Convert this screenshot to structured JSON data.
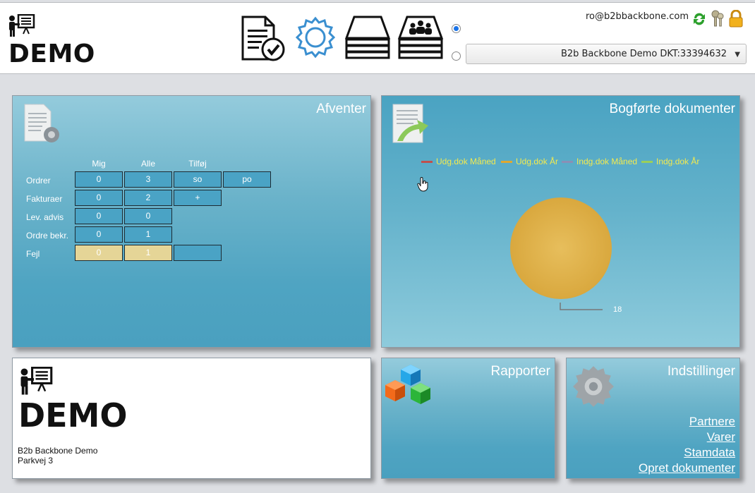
{
  "header": {
    "logo_text": "DEMO",
    "user_email": "ro@b2bbackbone.com",
    "company_select": "B2b Backbone Demo DKT:33394632",
    "toolbar_icons": [
      "documents-approve-icon",
      "settings-gear-icon",
      "stack-icon",
      "users-stack-icon"
    ],
    "top_icons": [
      "refresh-icon",
      "keys-icon",
      "lock-icon"
    ],
    "radio_selected": 1
  },
  "afventer": {
    "title": "Afventer",
    "columns": [
      "Mig",
      "Alle",
      "Tilføj"
    ],
    "rows": [
      {
        "label": "Ordrer",
        "mig": "0",
        "alle": "3",
        "add": [
          "so",
          "po"
        ]
      },
      {
        "label": "Fakturaer",
        "mig": "0",
        "alle": "2",
        "add": [
          "+"
        ]
      },
      {
        "label": "Lev. advis",
        "mig": "0",
        "alle": "0",
        "add": []
      },
      {
        "label": "Ordre bekr.",
        "mig": "0",
        "alle": "1",
        "add": []
      },
      {
        "label": "Fejl",
        "mig": "0",
        "alle": "1",
        "add": [
          ""
        ]
      }
    ]
  },
  "bogforte": {
    "title": "Bogførte dokumenter",
    "legend": [
      {
        "label": "Udg.dok Måned",
        "color": "#c0504d"
      },
      {
        "label": "Udg.dok År",
        "color": "#e0a830"
      },
      {
        "label": "Indg.dok Måned",
        "color": "#8a8fb5"
      },
      {
        "label": "Indg.dok År",
        "color": "#9bcf5a"
      }
    ],
    "value_label": "18",
    "pie_color": "#e3b650"
  },
  "demo_card": {
    "logo_text": "DEMO",
    "company": "B2b Backbone Demo",
    "address": "Parkvej 3"
  },
  "rapporter": {
    "title": "Rapporter"
  },
  "indstillinger": {
    "title": "Indstillinger",
    "links": [
      "Partnere",
      "Varer",
      "Stamdata",
      "Opret dokumenter"
    ]
  }
}
